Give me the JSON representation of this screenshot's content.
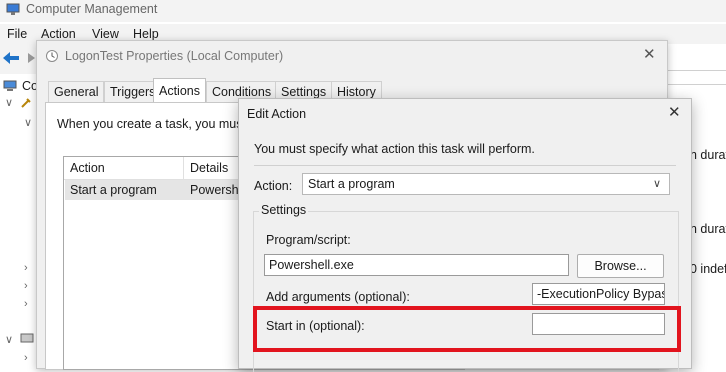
{
  "computer_management": {
    "title": "Computer Management",
    "menu": [
      "File",
      "Action",
      "View",
      "Help"
    ],
    "tree_partial": "Co",
    "right_column": [
      "n durati",
      "n durati",
      "0 indef"
    ]
  },
  "properties_dialog": {
    "title": "LogonTest Properties (Local Computer)",
    "tabs": [
      "General",
      "Triggers",
      "Actions",
      "Conditions",
      "Settings",
      "History"
    ],
    "active_tab": "Actions",
    "intro": "When you create a task, you must",
    "list": {
      "columns": [
        "Action",
        "Details"
      ],
      "rows": [
        {
          "action": "Start a program",
          "details": "Powershell"
        }
      ]
    }
  },
  "edit_action": {
    "title": "Edit Action",
    "message": "You must specify what action this task will perform.",
    "action_label": "Action:",
    "action_value": "Start a program",
    "settings_label": "Settings",
    "program_label": "Program/script:",
    "program_value": "Powershell.exe",
    "browse_label": "Browse...",
    "args_label": "Add arguments (optional):",
    "args_value": "-ExecutionPolicy Bypass",
    "start_in_label": "Start in (optional):",
    "start_in_value": ""
  },
  "colors": {
    "highlight": "#e2141e",
    "dialog_bg": "#f0f0f0"
  }
}
